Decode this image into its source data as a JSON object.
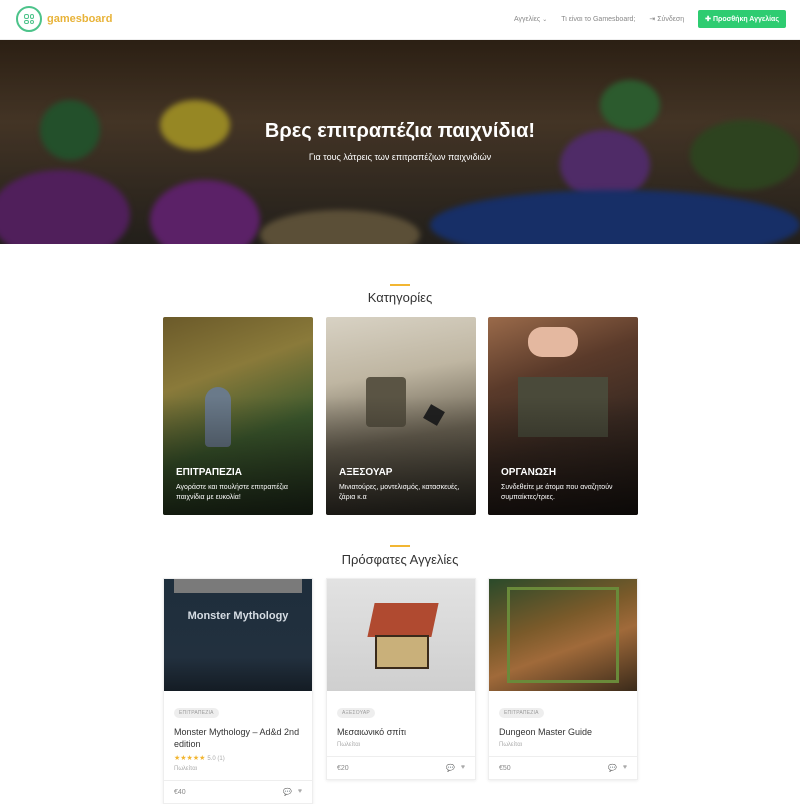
{
  "nav": {
    "logo_text": "gamesboard",
    "links": [
      {
        "label": "Αγγελίες",
        "icon": "chevron-down-icon"
      },
      {
        "label": "Τι είναι το Gamesboard;"
      },
      {
        "label": "Σύνδεση",
        "icon": "login-icon"
      }
    ],
    "add_button": "Προσθήκη Αγγελίας",
    "add_button_color": "#2ecc71"
  },
  "hero": {
    "title": "Βρες επιτραπέζια παιχνίδια!",
    "subtitle": "Για τους λάτρεις των επιτραπέζιων παιχνιδιών"
  },
  "categories": {
    "title": "Κατηγορίες",
    "items": [
      {
        "title": "ΕΠΙΤΡΑΠΕΖΙΑ",
        "desc": "Αγοράστε και πουλήστε επιτραπέζια παιχνίδια με ευκολία!"
      },
      {
        "title": "ΑΞΕΣΟΥΑΡ",
        "desc": "Μινιατούρες, μοντελισμός, κατασκευές, ζάρια κ.α"
      },
      {
        "title": "ΟΡΓΑΝΩΣΗ",
        "desc": "Συνδεθείτε με άτομα που αναζητούν συμπαίκτες/τριες."
      }
    ]
  },
  "listings": {
    "title": "Πρόσφατες Αγγελίες",
    "items": [
      {
        "badge": "ΕΠΙΤΡΑΠΕΖΙΑ",
        "title": "Monster Mythology – Ad&d 2nd edition",
        "stars": "★★★★★",
        "rating": "5.0 (1)",
        "sale": "Πωλείται",
        "price": "€40",
        "cover_text": "Monster Mythology"
      },
      {
        "badge": "ΑΞΕΣΟΥΑΡ",
        "title": "Μεσαιωνικό σπίτι",
        "sale": "Πωλείται",
        "price": "€20"
      },
      {
        "badge": "ΕΠΙΤΡΑΠΕΖΙΑ",
        "title": "Dungeon Master Guide",
        "sale": "Πωλείται",
        "price": "€50"
      }
    ]
  },
  "colors": {
    "accent": "#f2b632",
    "brand": "#4cc38a"
  }
}
